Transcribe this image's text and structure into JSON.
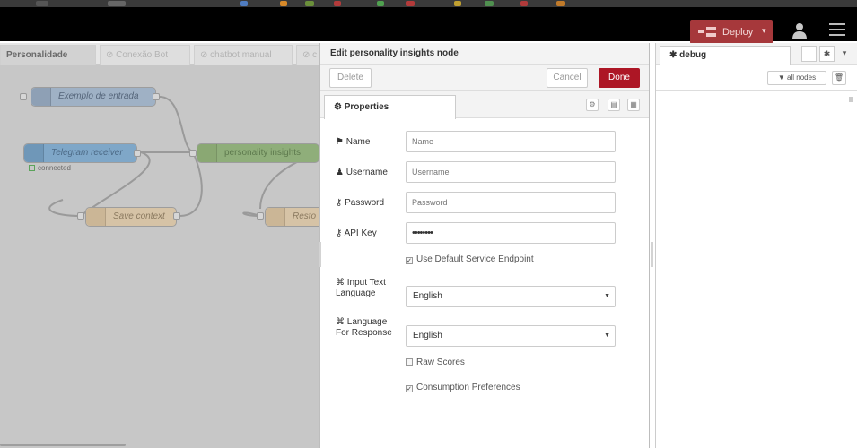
{
  "header": {
    "deploy_label": "Deploy",
    "deploy_caret": "▾",
    "user_icon": "user-icon",
    "menu_icon": "menu-icon",
    "accent_color": "#a6383b"
  },
  "workspace": {
    "tabs": [
      {
        "label": "Personalidade",
        "active": true
      },
      {
        "label": "⊘ Conexão Bot",
        "active": false
      },
      {
        "label": "⊘ chatbot manual",
        "active": false
      },
      {
        "label": "⊘ c",
        "active": false
      }
    ],
    "nodes": [
      {
        "label": "Exemplo de entrada",
        "icon": "inject-icon"
      },
      {
        "label": "Telegram receiver",
        "icon": "telegram-icon"
      },
      {
        "label": "personality insights",
        "icon": "watson-icon"
      },
      {
        "label": "Save context",
        "icon": "function-icon"
      },
      {
        "label": "Resto",
        "icon": "function-icon"
      }
    ],
    "status_text": "connected"
  },
  "tray": {
    "title": "Edit personality insights node",
    "delete_label": "Delete",
    "cancel_label": "Cancel",
    "done_label": "Done",
    "properties_tab": "⚙ Properties",
    "tool_icons": [
      "settings-icon",
      "description-icon",
      "appearance-icon"
    ],
    "form": {
      "name_label": "Name",
      "name_placeholder": "Name",
      "username_label": "Username",
      "username_placeholder": "Username",
      "password_label": "Password",
      "password_placeholder": "Password",
      "apikey_label": "API Key",
      "apikey_value": "••••••••",
      "default_endpoint_label": "Use Default Service Endpoint",
      "default_endpoint_checked": true,
      "input_lang_label_1": "Input Text",
      "input_lang_label_2": "Language",
      "input_lang_value": "English",
      "response_lang_label_1": "Language",
      "response_lang_label_2": "For Response",
      "response_lang_value": "English",
      "raw_scores_label": "Raw Scores",
      "raw_scores_checked": false,
      "consumption_label": "Consumption Preferences",
      "consumption_checked": true
    }
  },
  "sidebar": {
    "tab_label": "debug",
    "tab_icon": "bug-icon",
    "info_button": "i",
    "debug_button": "bug-icon",
    "filter_label": "all nodes",
    "filter_icon": "filter-icon",
    "clear_icon": "trash-icon"
  }
}
